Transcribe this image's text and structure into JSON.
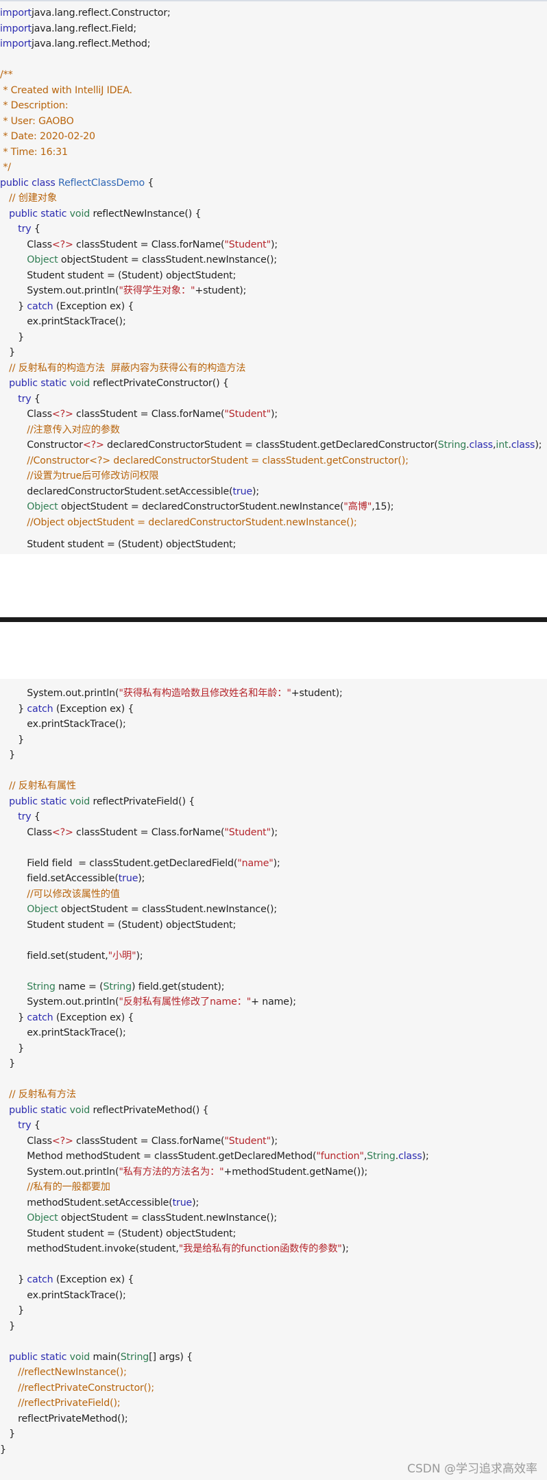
{
  "block1": {
    "lines": [
      [
        [
          "kw",
          "import"
        ],
        [
          "",
          "java.lang.reflect.Constructor;"
        ]
      ],
      [
        [
          "kw",
          "import"
        ],
        [
          "",
          "java.lang.reflect.Field;"
        ]
      ],
      [
        [
          "kw",
          "import"
        ],
        [
          "",
          "java.lang.reflect.Method;"
        ]
      ],
      [],
      [
        [
          "cm",
          "/**"
        ]
      ],
      [
        [
          "cm",
          " * Created with IntelliJ IDEA."
        ]
      ],
      [
        [
          "cm",
          " * Description:"
        ]
      ],
      [
        [
          "cm",
          " * User: GAOBO"
        ]
      ],
      [
        [
          "cm",
          " * Date: 2020-02-20"
        ]
      ],
      [
        [
          "cm",
          " * Time: 16:31"
        ]
      ],
      [
        [
          "cm",
          " */"
        ]
      ],
      [
        [
          "kw",
          "public class"
        ],
        [
          "",
          " "
        ],
        [
          "cn",
          "ReflectClassDemo"
        ],
        [
          "",
          " {"
        ]
      ],
      [
        [
          "",
          "   "
        ],
        [
          "cm",
          "// 创建对象"
        ]
      ],
      [
        [
          "",
          "   "
        ],
        [
          "kw",
          "public static"
        ],
        [
          "",
          " "
        ],
        [
          "ty",
          "void"
        ],
        [
          "",
          " reflectNewInstance() {"
        ]
      ],
      [
        [
          "",
          "      "
        ],
        [
          "kw",
          "try"
        ],
        [
          "",
          " {"
        ]
      ],
      [
        [
          "",
          "         Class"
        ],
        [
          "gn",
          "<?>"
        ],
        [
          "",
          " classStudent = Class.forName("
        ],
        [
          "st",
          "\"Student\""
        ],
        [
          "",
          ");"
        ]
      ],
      [
        [
          "",
          "         "
        ],
        [
          "ty",
          "Object"
        ],
        [
          "",
          " objectStudent = classStudent.newInstance();"
        ]
      ],
      [
        [
          "",
          "         Student student = (Student) objectStudent;"
        ]
      ],
      [
        [
          "",
          "         System.out.println("
        ],
        [
          "st",
          "\"获得学生对象：\""
        ],
        [
          "",
          "+student);"
        ]
      ],
      [
        [
          "",
          "      } "
        ],
        [
          "kw",
          "catch"
        ],
        [
          "",
          " (Exception ex) {"
        ]
      ],
      [
        [
          "",
          "         ex.printStackTrace();"
        ]
      ],
      [
        [
          "",
          "      }"
        ]
      ],
      [
        [
          "",
          "   }"
        ]
      ],
      [
        [
          "",
          "   "
        ],
        [
          "cm",
          "// 反射私有的构造方法  屏蔽内容为获得公有的构造方法"
        ]
      ],
      [
        [
          "",
          "   "
        ],
        [
          "kw",
          "public static"
        ],
        [
          "",
          " "
        ],
        [
          "ty",
          "void"
        ],
        [
          "",
          " reflectPrivateConstructor() {"
        ]
      ],
      [
        [
          "",
          "      "
        ],
        [
          "kw",
          "try"
        ],
        [
          "",
          " {"
        ]
      ],
      [
        [
          "",
          "         Class"
        ],
        [
          "gn",
          "<?>"
        ],
        [
          "",
          " classStudent = Class.forName("
        ],
        [
          "st",
          "\"Student\""
        ],
        [
          "",
          ");"
        ]
      ],
      [
        [
          "",
          "         "
        ],
        [
          "cm",
          "//注意传入对应的参数"
        ]
      ],
      [
        [
          "",
          "         Constructor"
        ],
        [
          "gn",
          "<?>"
        ],
        [
          "",
          " declaredConstructorStudent = classStudent.getDeclaredConstructor("
        ],
        [
          "ty",
          "String"
        ],
        [
          "",
          "."
        ],
        [
          "kw",
          "class"
        ],
        [
          "",
          ","
        ],
        [
          "ty",
          "int"
        ],
        [
          "",
          "."
        ],
        [
          "kw",
          "class"
        ],
        [
          "",
          ");"
        ]
      ],
      [
        [
          "",
          "         "
        ],
        [
          "cm",
          "//Constructor<?> declaredConstructorStudent = classStudent.getConstructor();"
        ]
      ],
      [
        [
          "",
          "         "
        ],
        [
          "cm",
          "//设置为true后可修改访问权限"
        ]
      ],
      [
        [
          "",
          "         declaredConstructorStudent.setAccessible("
        ],
        [
          "kw",
          "true"
        ],
        [
          "",
          ");"
        ]
      ],
      [
        [
          "",
          "         "
        ],
        [
          "ty",
          "Object"
        ],
        [
          "",
          " objectStudent = declaredConstructorStudent.newInstance("
        ],
        [
          "st",
          "\"高博\""
        ],
        [
          "",
          ",15);"
        ]
      ],
      [
        [
          "",
          "         "
        ],
        [
          "cm",
          "//Object objectStudent = declaredConstructorStudent.newInstance();"
        ]
      ]
    ],
    "last_line": [
      [
        "",
        "         Student student = (Student) objectStudent;"
      ]
    ]
  },
  "block2": {
    "lines": [
      [
        [
          "",
          "         System.out.println("
        ],
        [
          "st",
          "\"获得私有构造哈数且修改姓名和年龄：\""
        ],
        [
          "",
          "+student);"
        ]
      ],
      [
        [
          "",
          "      } "
        ],
        [
          "kw",
          "catch"
        ],
        [
          "",
          " (Exception ex) {"
        ]
      ],
      [
        [
          "",
          "         ex.printStackTrace();"
        ]
      ],
      [
        [
          "",
          "      }"
        ]
      ],
      [
        [
          "",
          "   }"
        ]
      ],
      [],
      [
        [
          "",
          "   "
        ],
        [
          "cm",
          "// 反射私有属性"
        ]
      ],
      [
        [
          "",
          "   "
        ],
        [
          "kw",
          "public static"
        ],
        [
          "",
          " "
        ],
        [
          "ty",
          "void"
        ],
        [
          "",
          " reflectPrivateField() {"
        ]
      ],
      [
        [
          "",
          "      "
        ],
        [
          "kw",
          "try"
        ],
        [
          "",
          " {"
        ]
      ],
      [
        [
          "",
          "         Class"
        ],
        [
          "gn",
          "<?>"
        ],
        [
          "",
          " classStudent = Class.forName("
        ],
        [
          "st",
          "\"Student\""
        ],
        [
          "",
          ");"
        ]
      ],
      [],
      [
        [
          "",
          "         Field field  = classStudent.getDeclaredField("
        ],
        [
          "st",
          "\"name\""
        ],
        [
          "",
          ");"
        ]
      ],
      [
        [
          "",
          "         field.setAccessible("
        ],
        [
          "kw",
          "true"
        ],
        [
          "",
          ");"
        ]
      ],
      [
        [
          "",
          "         "
        ],
        [
          "cm",
          "//可以修改该属性的值"
        ]
      ],
      [
        [
          "",
          "         "
        ],
        [
          "ty",
          "Object"
        ],
        [
          "",
          " objectStudent = classStudent.newInstance();"
        ]
      ],
      [
        [
          "",
          "         Student student = (Student) objectStudent;"
        ]
      ],
      [],
      [
        [
          "",
          "         field.set(student,"
        ],
        [
          "st",
          "\"小明\""
        ],
        [
          "",
          ");"
        ]
      ],
      [],
      [
        [
          "",
          "         "
        ],
        [
          "ty",
          "String"
        ],
        [
          "",
          " name = ("
        ],
        [
          "ty",
          "String"
        ],
        [
          "",
          ") field.get(student);"
        ]
      ],
      [
        [
          "",
          "         System.out.println("
        ],
        [
          "st",
          "\"反射私有属性修改了name：\""
        ],
        [
          "",
          "+ name);"
        ]
      ],
      [
        [
          "",
          "      } "
        ],
        [
          "kw",
          "catch"
        ],
        [
          "",
          " (Exception ex) {"
        ]
      ],
      [
        [
          "",
          "         ex.printStackTrace();"
        ]
      ],
      [
        [
          "",
          "      }"
        ]
      ],
      [
        [
          "",
          "   }"
        ]
      ],
      [],
      [
        [
          "",
          "   "
        ],
        [
          "cm",
          "// 反射私有方法"
        ]
      ],
      [
        [
          "",
          "   "
        ],
        [
          "kw",
          "public static"
        ],
        [
          "",
          " "
        ],
        [
          "ty",
          "void"
        ],
        [
          "",
          " reflectPrivateMethod() {"
        ]
      ],
      [
        [
          "",
          "      "
        ],
        [
          "kw",
          "try"
        ],
        [
          "",
          " {"
        ]
      ],
      [
        [
          "",
          "         Class"
        ],
        [
          "gn",
          "<?>"
        ],
        [
          "",
          " classStudent = Class.forName("
        ],
        [
          "st",
          "\"Student\""
        ],
        [
          "",
          ");"
        ]
      ],
      [
        [
          "",
          "         Method methodStudent = classStudent.getDeclaredMethod("
        ],
        [
          "st",
          "\"function\""
        ],
        [
          "",
          ","
        ],
        [
          "ty",
          "String"
        ],
        [
          "",
          "."
        ],
        [
          "kw",
          "class"
        ],
        [
          "",
          ");"
        ]
      ],
      [
        [
          "",
          "         System.out.println("
        ],
        [
          "st",
          "\"私有方法的方法名为：\""
        ],
        [
          "",
          "+methodStudent.getName());"
        ]
      ],
      [
        [
          "",
          "         "
        ],
        [
          "cm",
          "//私有的一般都要加"
        ]
      ],
      [
        [
          "",
          "         methodStudent.setAccessible("
        ],
        [
          "kw",
          "true"
        ],
        [
          "",
          ");"
        ]
      ],
      [
        [
          "",
          "         "
        ],
        [
          "ty",
          "Object"
        ],
        [
          "",
          " objectStudent = classStudent.newInstance();"
        ]
      ],
      [
        [
          "",
          "         Student student = (Student) objectStudent;"
        ]
      ],
      [
        [
          "",
          "         methodStudent.invoke(student,"
        ],
        [
          "st",
          "\"我是给私有的function函数传的参数\""
        ],
        [
          "",
          ");"
        ]
      ],
      [],
      [
        [
          "",
          "      } "
        ],
        [
          "kw",
          "catch"
        ],
        [
          "",
          " (Exception ex) {"
        ]
      ],
      [
        [
          "",
          "         ex.printStackTrace();"
        ]
      ],
      [
        [
          "",
          "      }"
        ]
      ],
      [
        [
          "",
          "   }"
        ]
      ],
      [],
      [
        [
          "",
          "   "
        ],
        [
          "kw",
          "public static"
        ],
        [
          "",
          " "
        ],
        [
          "ty",
          "void"
        ],
        [
          "",
          " main("
        ],
        [
          "ty",
          "String"
        ],
        [
          "",
          "[] args) {"
        ]
      ],
      [
        [
          "",
          "      "
        ],
        [
          "cm",
          "//reflectNewInstance();"
        ]
      ],
      [
        [
          "",
          "      "
        ],
        [
          "cm",
          "//reflectPrivateConstructor();"
        ]
      ],
      [
        [
          "",
          "      "
        ],
        [
          "cm",
          "//reflectPrivateField();"
        ]
      ],
      [
        [
          "",
          "      reflectPrivateMethod();"
        ]
      ],
      [
        [
          "",
          "   }"
        ]
      ],
      [
        [
          "",
          "}"
        ]
      ]
    ]
  },
  "watermark": "CSDN @学习追求高效率"
}
